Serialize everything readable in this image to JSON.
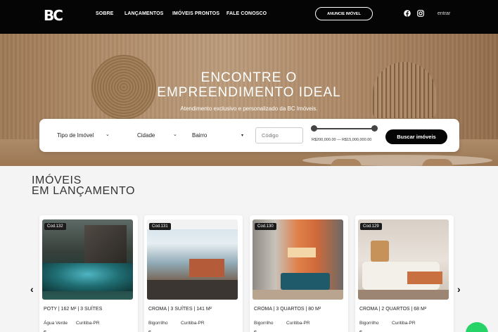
{
  "header": {
    "logo": "BC",
    "nav": [
      "SOBRE",
      "LANÇAMENTOS",
      "IMÓVEIS PRONTOS",
      "FALE CONOSCO"
    ],
    "cta": "ANUNCIE IMÓVEL",
    "social_icons": [
      "facebook-icon",
      "instagram-icon"
    ],
    "login": "entrar"
  },
  "hero": {
    "title_line1": "ENCONTRE O",
    "title_line2": "EMPREENDIMENTO IDEAL",
    "subtitle": "Atendimento exclusivo e personalizado da BC Imóveis."
  },
  "search": {
    "type_label": "Tipo de Imóvel",
    "city_label": "Cidade",
    "neighborhood_label": "Bairro",
    "code_placeholder": "Código",
    "price_range_text": "R$200,000.00 — R$15,000,000.00",
    "price_min": 200000,
    "price_max": 15000000,
    "button": "Buscar imóveis"
  },
  "section": {
    "title_line1": "IMÓVEIS",
    "title_line2": "EM LANÇAMENTO"
  },
  "cards": [
    {
      "code": "Cod.132",
      "name": "POTY | 162 M² | 3 SUÍTES",
      "neighborhood": "Água Verde",
      "city": "Curitiba-PR",
      "price": "$"
    },
    {
      "code": "Cod.131",
      "name": "CROMA | 3 SUÍTES | 141 M²",
      "neighborhood": "Bigorrilho",
      "city": "Curitiba-PR",
      "price": "$"
    },
    {
      "code": "Cod.130",
      "name": "CROMA | 3 QUARTOS | 80 M²",
      "neighborhood": "Bigorrilho",
      "city": "Curitiba-PR",
      "price": "$"
    },
    {
      "code": "Cod.129",
      "name": "CROMA | 2 QUARTOS | 68 M²",
      "neighborhood": "Bigorrilho",
      "city": "Curitiba-PR",
      "price": "$"
    }
  ],
  "carousel": {
    "prev": "‹",
    "next": "›"
  },
  "colors": {
    "header_bg": "#050505",
    "accent_dark": "#050505",
    "whatsapp": "#25d366"
  }
}
